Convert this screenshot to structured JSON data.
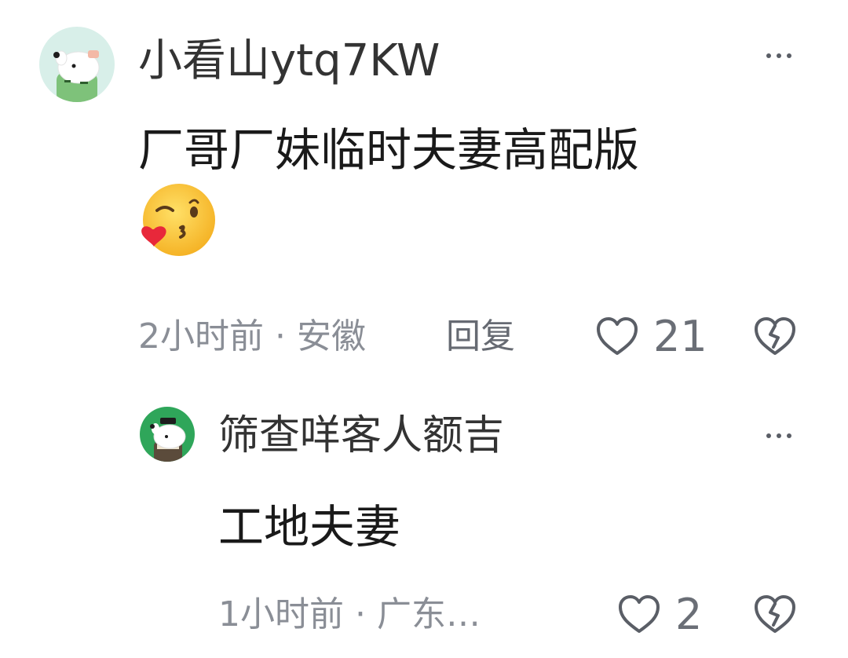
{
  "comment": {
    "username": "小看山ytq7KW",
    "text": "厂哥厂妹临时夫妻高配版",
    "emoji": "face-blowing-kiss-emoji",
    "time": "2小时前",
    "location": "安徽",
    "separator": "·",
    "reply_label": "回复",
    "likes": "21"
  },
  "reply": {
    "username": "筛查咩客人额吉",
    "text": "工地夫妻",
    "time": "1小时前",
    "location": "广东…",
    "separator": "·",
    "likes": "2"
  },
  "icons": {
    "more": "more-dots-icon",
    "like": "heart-outline-icon",
    "dislike": "broken-heart-icon"
  },
  "colors": {
    "text_primary": "#1a1a1a",
    "text_meta": "#8a8e96",
    "icon": "#5a5e66"
  }
}
